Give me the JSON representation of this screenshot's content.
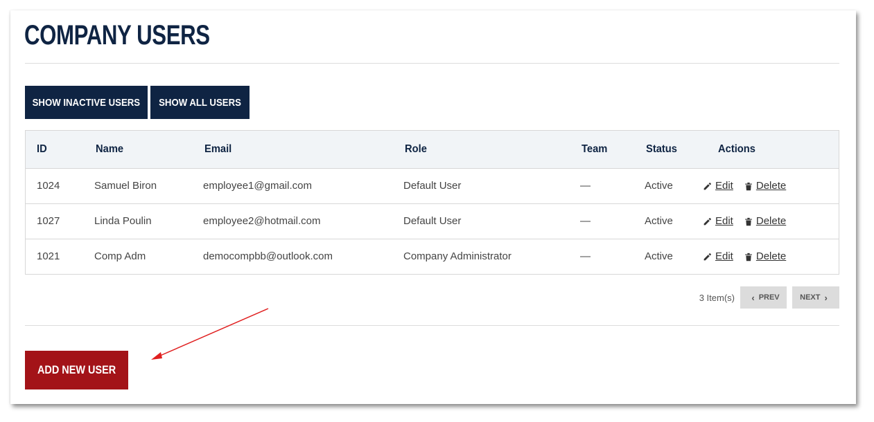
{
  "page": {
    "title": "COMPANY USERS"
  },
  "filters": {
    "inactive_label": "SHOW INACTIVE USERS",
    "all_label": "SHOW ALL USERS"
  },
  "table": {
    "headers": {
      "id": "ID",
      "name": "Name",
      "email": "Email",
      "role": "Role",
      "team": "Team",
      "status": "Status",
      "actions": "Actions"
    },
    "rows": [
      {
        "id": "1024",
        "name": "Samuel Biron",
        "email": "employee1@gmail.com",
        "role": "Default User",
        "team": "—",
        "status": "Active",
        "edit": "Edit",
        "delete": "Delete"
      },
      {
        "id": "1027",
        "name": "Linda Poulin",
        "email": "employee2@hotmail.com",
        "role": "Default User",
        "team": "—",
        "status": "Active",
        "edit": "Edit",
        "delete": "Delete"
      },
      {
        "id": "1021",
        "name": "Comp Adm",
        "email": "democompbb@outlook.com",
        "role": "Company Administrator",
        "team": "—",
        "status": "Active",
        "edit": "Edit",
        "delete": "Delete"
      }
    ]
  },
  "pagination": {
    "count": "3 Item(s)",
    "prev_label": "PREV",
    "next_label": "NEXT"
  },
  "add_button": {
    "label": "ADD NEW USER"
  },
  "colors": {
    "navy": "#0f2443",
    "brand_red": "#a31318",
    "annotation_arrow": "#e02020"
  },
  "icons": {
    "edit": "pencil-icon",
    "delete": "trash-icon",
    "prev": "chevron-left-icon",
    "next": "chevron-right-icon"
  }
}
